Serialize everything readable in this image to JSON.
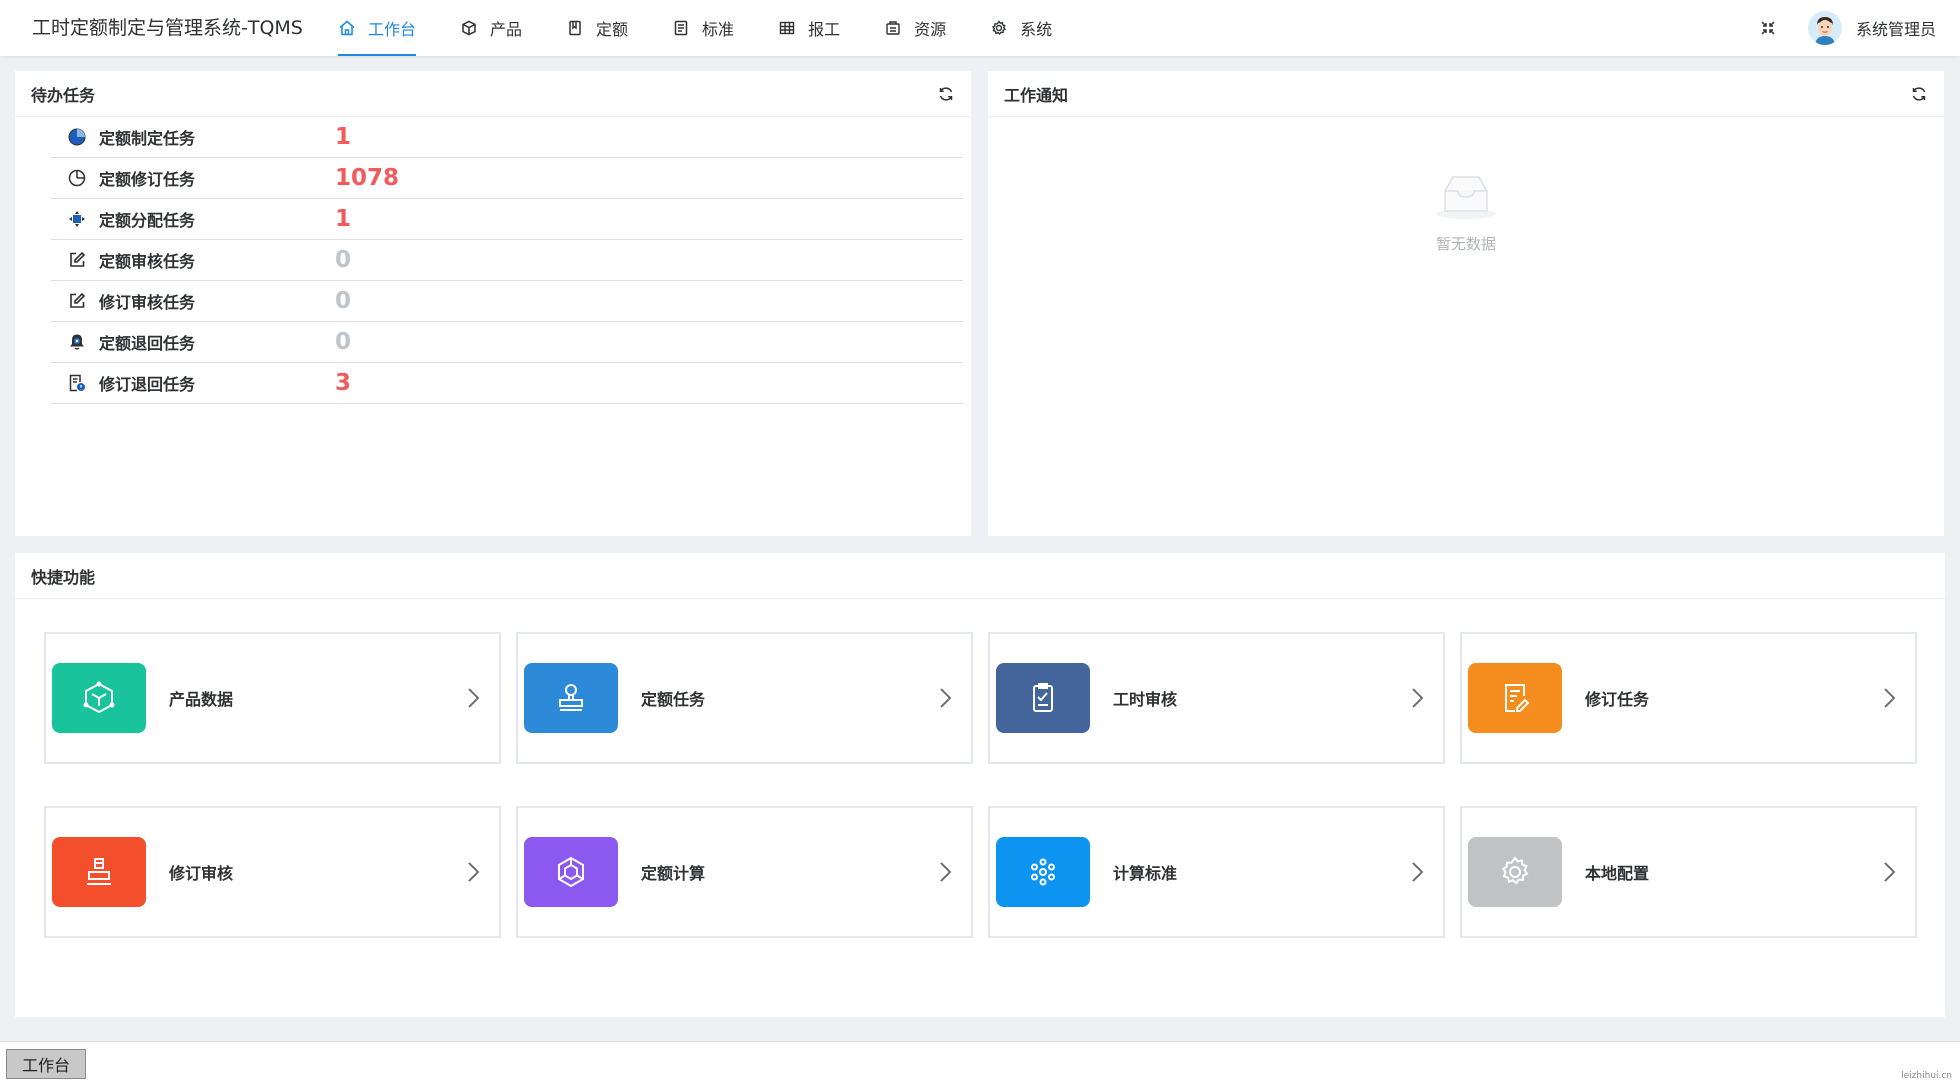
{
  "header": {
    "app_title": "工时定额制定与管理系统-TQMS",
    "nav": [
      {
        "label": "工作台",
        "icon": "home-icon",
        "active": true
      },
      {
        "label": "产品",
        "icon": "cube-icon"
      },
      {
        "label": "定额",
        "icon": "book-icon"
      },
      {
        "label": "标准",
        "icon": "list-doc-icon"
      },
      {
        "label": "报工",
        "icon": "table-icon"
      },
      {
        "label": "资源",
        "icon": "resource-icon"
      },
      {
        "label": "系统",
        "icon": "gear-icon"
      }
    ],
    "username": "系统管理员"
  },
  "todo": {
    "title": "待办任务",
    "tasks": [
      {
        "label": "定额制定任务",
        "count": "1",
        "icon": "pie-chart-icon"
      },
      {
        "label": "定额修订任务",
        "count": "1078",
        "icon": "pie-outline-icon"
      },
      {
        "label": "定额分配任务",
        "count": "1",
        "icon": "distribute-icon"
      },
      {
        "label": "定额审核任务",
        "count": "0",
        "icon": "edit-icon"
      },
      {
        "label": "修订审核任务",
        "count": "0",
        "icon": "edit-icon"
      },
      {
        "label": "定额退回任务",
        "count": "0",
        "icon": "bell-x-icon"
      },
      {
        "label": "修订退回任务",
        "count": "3",
        "icon": "doc-badge-icon"
      }
    ]
  },
  "notice": {
    "title": "工作通知",
    "empty_text": "暂无数据"
  },
  "quick": {
    "title": "快捷功能",
    "items": [
      {
        "label": "产品数据",
        "color": "#19c39b",
        "icon": "product-cube-icon"
      },
      {
        "label": "定额任务",
        "color": "#2d8ad8",
        "icon": "stamp-icon"
      },
      {
        "label": "工时审核",
        "color": "#44659b",
        "icon": "checklist-icon"
      },
      {
        "label": "修订任务",
        "color": "#f58c1e",
        "icon": "doc-edit-icon"
      },
      {
        "label": "修订审核",
        "color": "#f34f2c",
        "icon": "stamp-seal-icon"
      },
      {
        "label": "定额计算",
        "color": "#8b59f0",
        "icon": "hex-compute-icon"
      },
      {
        "label": "计算标准",
        "color": "#0d93f0",
        "icon": "flower-dots-icon"
      },
      {
        "label": "本地配置",
        "color": "#c0c2c6",
        "icon": "gear-config-icon"
      }
    ]
  },
  "footer": {
    "tab_label": "工作台",
    "watermark": "leizhihui.cn"
  }
}
